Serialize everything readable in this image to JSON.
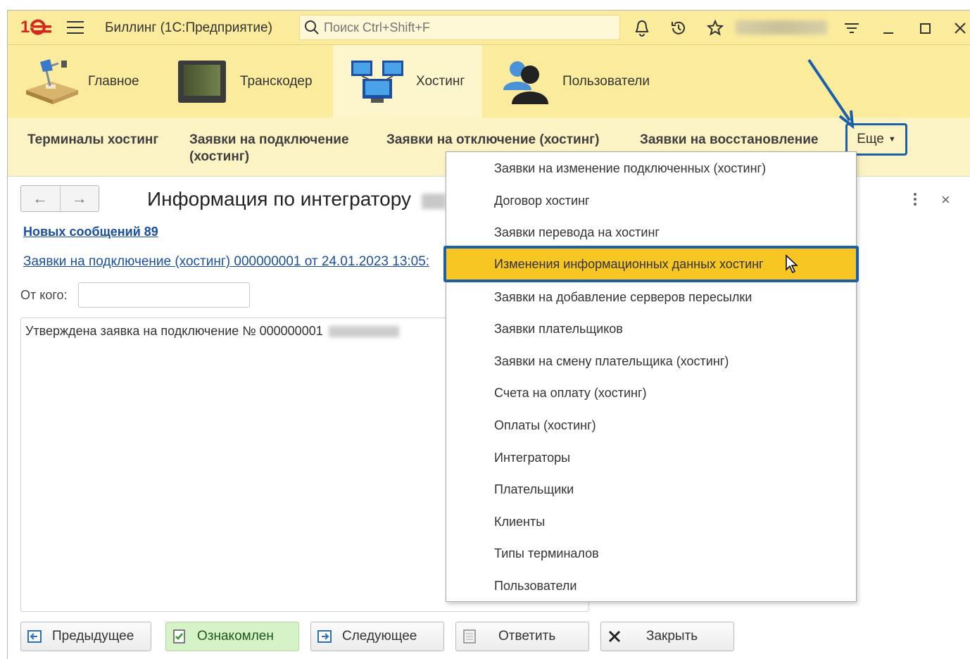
{
  "app": {
    "title": "Биллинг  (1С:Предприятие)",
    "search_placeholder": "Поиск Ctrl+Shift+F"
  },
  "sections": [
    {
      "label": "Главное",
      "icon": "desk-lamp-icon"
    },
    {
      "label": "Транскодер",
      "icon": "monitor-icon"
    },
    {
      "label": "Хостинг",
      "icon": "network-computers-icon",
      "active": true
    },
    {
      "label": "Пользователи",
      "icon": "users-icon"
    }
  ],
  "commands": {
    "items": [
      {
        "line1": "Терминалы хостинг",
        "line2": ""
      },
      {
        "line1": "Заявки на подключение",
        "line2": "(хостинг)"
      },
      {
        "line1": "Заявки на отключение (хостинг)",
        "line2": ""
      },
      {
        "line1": "Заявки на восстановление",
        "line2": ""
      }
    ],
    "more_label": "Еще"
  },
  "form": {
    "title": "Информация по интегратору",
    "new_messages_link": "Новых сообщений 89",
    "request_link": "Заявки на подключение (хостинг) 000000001 от 24.01.2023 13:05:",
    "from_label": "От кого:",
    "from_value": "",
    "message_text": "Утверждена заявка на подключение № 000000001"
  },
  "buttons": {
    "prev": "Предыдущее",
    "ack": "Ознакомлен",
    "next": "Следующее",
    "reply": "Ответить",
    "close": "Закрыть"
  },
  "dropdown": {
    "items": [
      "Заявки на изменение подключенных (хостинг)",
      "Договор хостинг",
      "Заявки перевода на хостинг",
      "Изменения информационных данных хостинг",
      "Заявки на добавление серверов пересылки",
      "Заявки плательщиков",
      "Заявки на смену плательщика (хостинг)",
      "Счета на оплату (хостинг)",
      "Оплаты (хостинг)",
      "Интеграторы",
      "Плательщики",
      "Клиенты",
      "Типы терминалов",
      "Пользователи"
    ],
    "highlighted_index": 3
  },
  "colors": {
    "toolbar_bg": "#fbeb9c",
    "highlight": "#f7c622",
    "accent_border": "#1a5fa8",
    "link": "#1a4fa0"
  }
}
